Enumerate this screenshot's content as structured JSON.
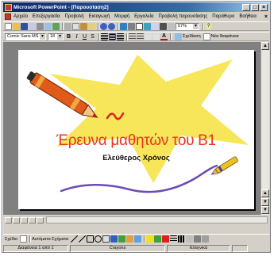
{
  "window": {
    "title": "Microsoft PowerPoint - [Παρουσίαση2]",
    "buttons": [
      "_",
      "□",
      "×"
    ]
  },
  "menu": {
    "items": [
      "Αρχείο",
      "Επεξεργασία",
      "Προβολή",
      "Εισαγωγή",
      "Μορφή",
      "Εργαλεία",
      "Προβολή παρουσίασης",
      "Παράθυρο",
      "Βοήθεια"
    ],
    "close": "×"
  },
  "toolbar_standard": {
    "zoom": "57%",
    "help": "?"
  },
  "toolbar_format": {
    "font": "Comic Sans MS",
    "size": "18",
    "bold": "B",
    "italic": "I",
    "underline": "U",
    "shadow": "S",
    "font_color": "A",
    "design": "Σχεδίαση",
    "new_slide": "Νέα διαφάνεια"
  },
  "slide": {
    "title": "Έρευνα μαθητών του Β1",
    "subtitle": "Ελεύθερος Χρόνος",
    "colors": {
      "star": "#f7e65a",
      "title": "#e8341c",
      "squiggle": "#6c4ab8",
      "red_squiggle": "#e02020"
    }
  },
  "drawing_toolbar": {
    "draw": "Σχέδιο",
    "autoshapes": "Αυτόματα Σχήματα"
  },
  "status": {
    "slide": "Διαφάνεια 1 από 1",
    "design": "Crayons",
    "language": "Ελληνικά"
  }
}
